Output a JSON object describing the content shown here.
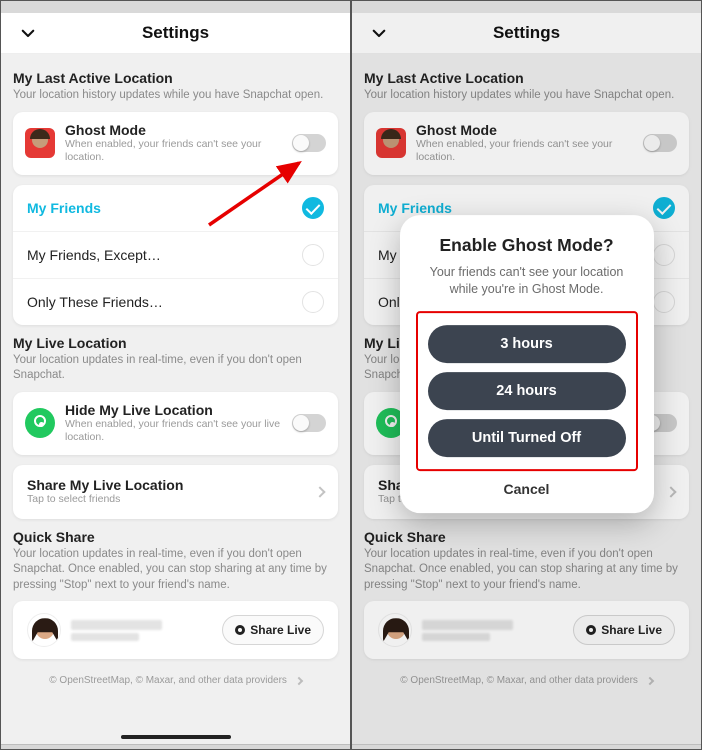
{
  "header": {
    "title": "Settings"
  },
  "lastActive": {
    "title": "My Last Active Location",
    "sub": "Your location history updates while you have Snapchat open.",
    "ghost": {
      "title": "Ghost Mode",
      "sub": "When enabled, your friends can't see your location."
    },
    "options": {
      "friends": "My Friends",
      "except": "My Friends, Except…",
      "only": "Only These Friends…"
    }
  },
  "live": {
    "title": "My Live Location",
    "sub": "Your location updates in real-time, even if you don't open Snapchat.",
    "hide": {
      "title": "Hide My Live Location",
      "sub": "When enabled, your friends can't see your live location."
    },
    "share": {
      "title": "Share My Live Location",
      "sub": "Tap to select friends"
    }
  },
  "quick": {
    "title": "Quick Share",
    "sub": "Your location updates in real-time, even if you don't open Snapchat. Once enabled, you can stop sharing at any time by pressing \"Stop\" next to your friend's name.",
    "pill": "Share Live"
  },
  "footer": "© OpenStreetMap, © Maxar, and other data providers",
  "modal": {
    "title": "Enable Ghost Mode?",
    "sub": "Your friends can't see your location while you're in Ghost Mode.",
    "opt1": "3 hours",
    "opt2": "24 hours",
    "opt3": "Until Turned Off",
    "cancel": "Cancel"
  }
}
